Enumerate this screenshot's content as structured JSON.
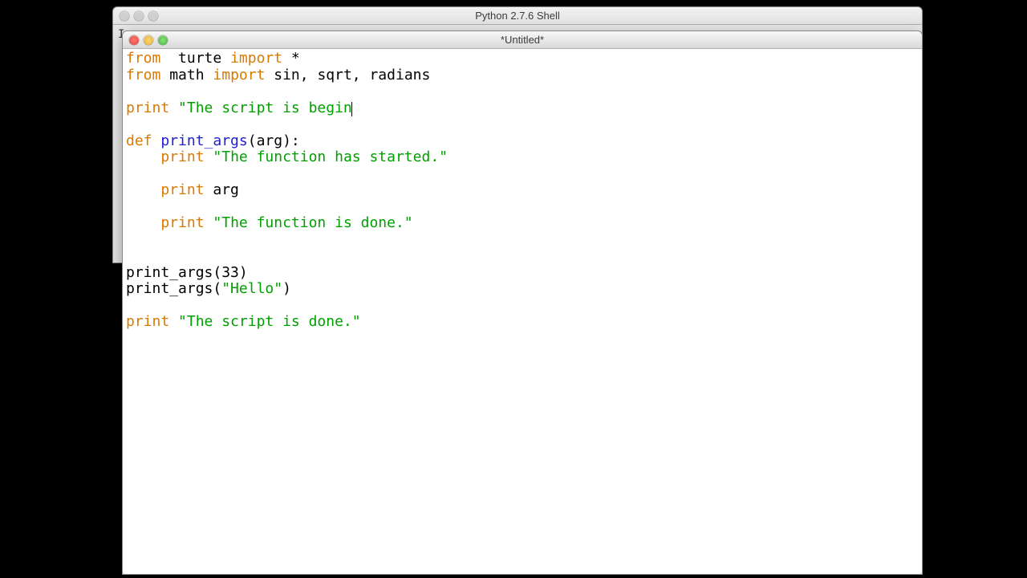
{
  "bg_window": {
    "title": "Python 2.7.6 Shell",
    "partial_text": "I"
  },
  "fg_window": {
    "title": "*Untitled*"
  },
  "code": {
    "tokens": [
      [
        [
          "kw",
          "from"
        ],
        [
          "",
          "  turte "
        ],
        [
          "kw",
          "import"
        ],
        [
          "",
          " *"
        ]
      ],
      [
        [
          "kw",
          "from"
        ],
        [
          "",
          " math "
        ],
        [
          "kw",
          "import"
        ],
        [
          "",
          " sin, sqrt, radians"
        ]
      ],
      [
        [
          "",
          ""
        ]
      ],
      [
        [
          "kw",
          "print"
        ],
        [
          "",
          " "
        ],
        [
          "str",
          "\"The script is begin"
        ],
        [
          "cursor",
          ""
        ]
      ],
      [
        [
          "",
          ""
        ]
      ],
      [
        [
          "kw",
          "def"
        ],
        [
          "",
          " "
        ],
        [
          "fun",
          "print_args"
        ],
        [
          "",
          "(arg):"
        ]
      ],
      [
        [
          "",
          "    "
        ],
        [
          "kw",
          "print"
        ],
        [
          "",
          " "
        ],
        [
          "str",
          "\"The function has started.\""
        ]
      ],
      [
        [
          "",
          ""
        ]
      ],
      [
        [
          "",
          "    "
        ],
        [
          "kw",
          "print"
        ],
        [
          "",
          " arg"
        ]
      ],
      [
        [
          "",
          ""
        ]
      ],
      [
        [
          "",
          "    "
        ],
        [
          "kw",
          "print"
        ],
        [
          "",
          " "
        ],
        [
          "str",
          "\"The function is done.\""
        ]
      ],
      [
        [
          "",
          ""
        ]
      ],
      [
        [
          "",
          ""
        ]
      ],
      [
        [
          "",
          "print_args(33)"
        ]
      ],
      [
        [
          "",
          "print_args("
        ],
        [
          "str",
          "\"Hello\""
        ],
        [
          "",
          ")"
        ]
      ],
      [
        [
          "",
          ""
        ]
      ],
      [
        [
          "kw",
          "print"
        ],
        [
          "",
          " "
        ],
        [
          "str",
          "\"The script is done.\""
        ]
      ]
    ]
  },
  "colors": {
    "keyword": "#d97a00",
    "string": "#00a000",
    "defname": "#2020d0"
  }
}
